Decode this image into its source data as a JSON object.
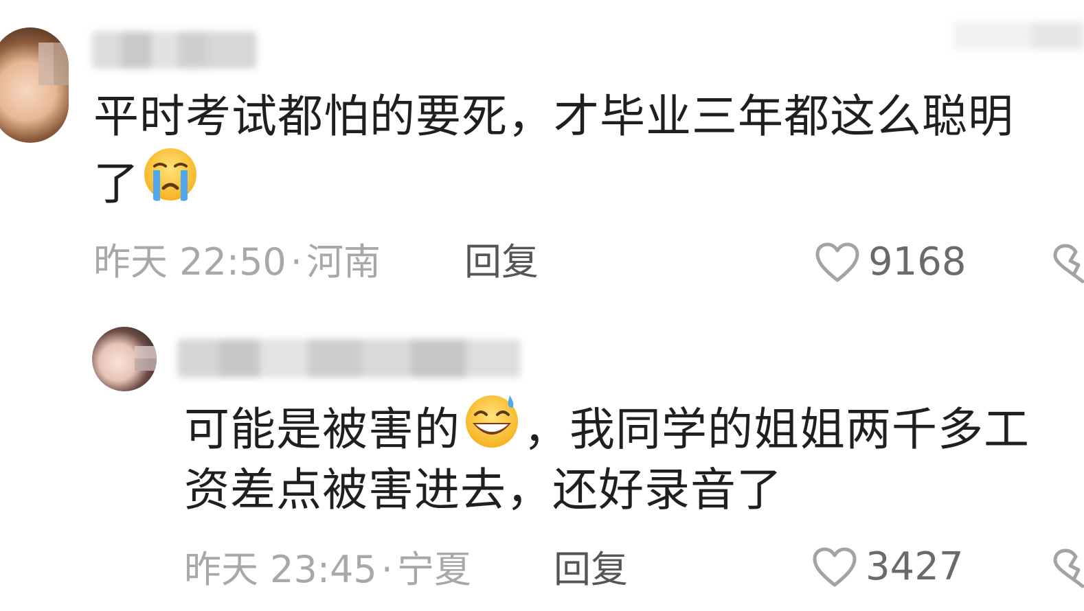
{
  "comments": [
    {
      "text_line1": "平时考试都怕的要死，才毕业三年都这么聪明",
      "text_line2": "了",
      "emoji": "crying-face",
      "time": "昨天 22:50",
      "dot": "·",
      "location": "河南",
      "reply_label": "回复",
      "likes": "9168"
    },
    {
      "text_line1_a": "可能是被害的",
      "emoji": "grinning-sweat-face",
      "text_line1_b": "，我同学的姐姐两千多工",
      "text_line2": "资差点被害进去，还好录音了",
      "time": "昨天 23:45",
      "dot": "·",
      "location": "宁夏",
      "reply_label": "回复",
      "likes": "3427"
    }
  ],
  "icons": {
    "like": "heart-outline-icon",
    "dislike": "broken-heart-icon"
  },
  "colors": {
    "text": "#1f1f1f",
    "meta": "#a8a8a8",
    "reply": "#555555",
    "like_count": "#6a6a6a",
    "background": "#ffffff"
  }
}
